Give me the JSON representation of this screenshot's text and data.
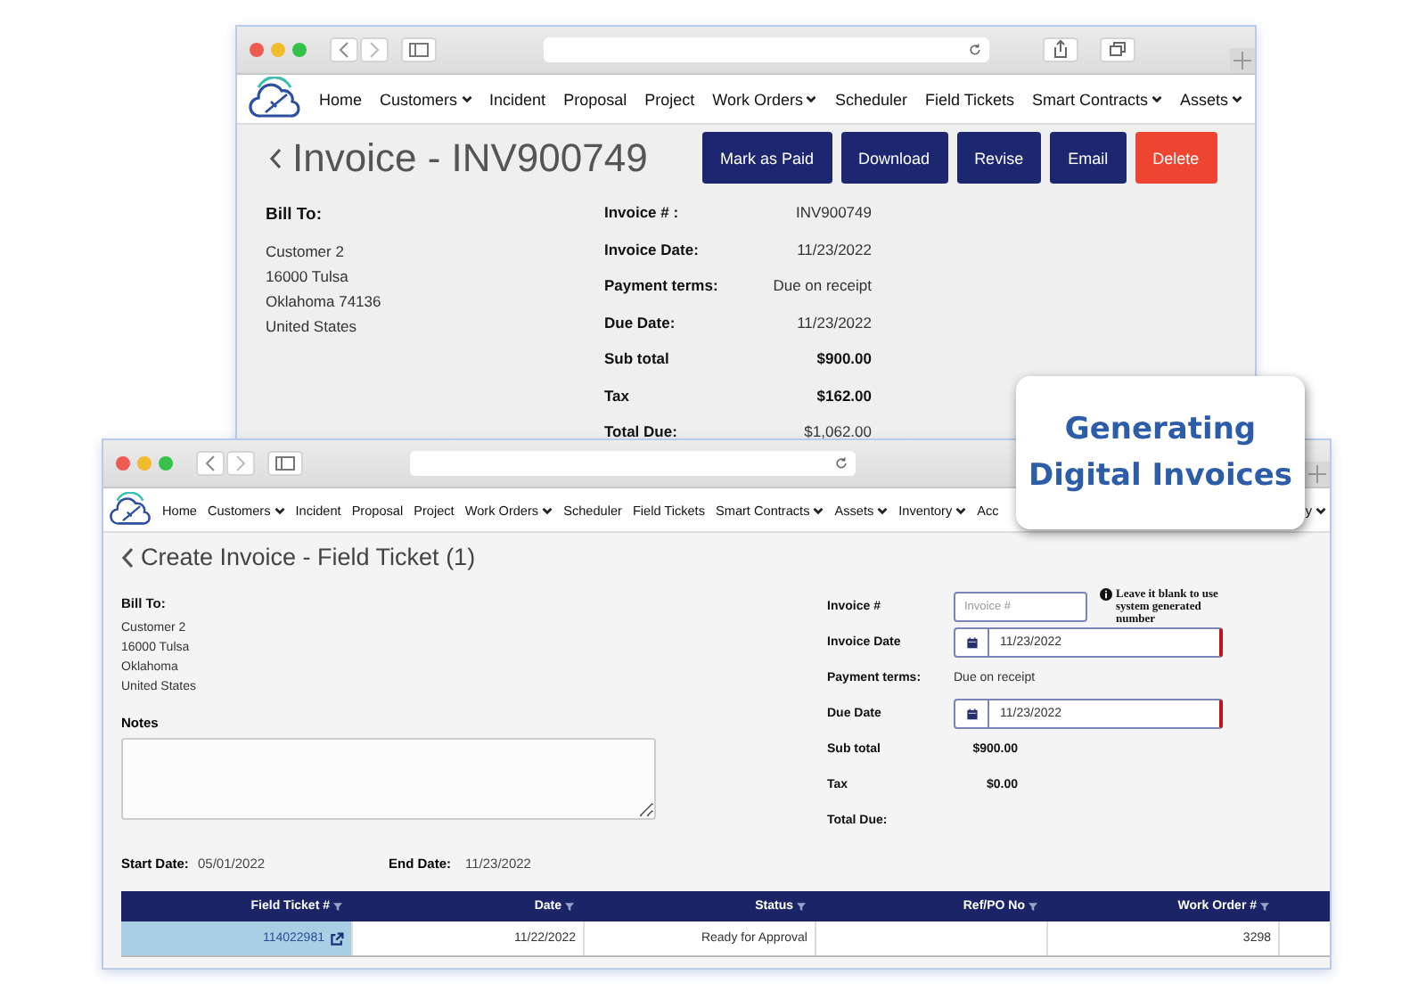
{
  "invoice_window": {
    "nav": [
      {
        "label": "Home",
        "dropdown": false
      },
      {
        "label": "Customers",
        "dropdown": true
      },
      {
        "label": "Incident",
        "dropdown": false
      },
      {
        "label": "Proposal",
        "dropdown": false
      },
      {
        "label": "Project",
        "dropdown": false
      },
      {
        "label": "Work Orders",
        "dropdown": true
      },
      {
        "label": "Scheduler",
        "dropdown": false
      },
      {
        "label": "Field Tickets",
        "dropdown": false
      },
      {
        "label": "Smart Contracts",
        "dropdown": true
      },
      {
        "label": "Assets",
        "dropdown": true
      }
    ],
    "title": "Invoice - INV900749",
    "buttons": [
      {
        "label": "Mark as Paid",
        "kind": "primary"
      },
      {
        "label": "Download",
        "kind": "primary"
      },
      {
        "label": "Revise",
        "kind": "primary"
      },
      {
        "label": "Email",
        "kind": "primary"
      },
      {
        "label": "Delete",
        "kind": "danger"
      }
    ],
    "bill_to": {
      "label": "Bill To:",
      "lines": [
        "Customer 2",
        "16000 Tulsa",
        "Oklahoma 74136",
        "United States"
      ]
    },
    "details": [
      {
        "label": "Invoice # :",
        "value": "INV900749",
        "bold": false
      },
      {
        "label": "Invoice Date:",
        "value": "11/23/2022",
        "bold": false
      },
      {
        "label": "Payment terms:",
        "value": "Due on receipt",
        "bold": false
      },
      {
        "label": "Due Date:",
        "value": "11/23/2022",
        "bold": false
      },
      {
        "label": "Sub total",
        "value": "$900.00",
        "bold": true
      },
      {
        "label": "Tax",
        "value": "$162.00",
        "bold": true
      },
      {
        "label": "Total Due:",
        "value": "$1,062.00",
        "bold": false
      }
    ]
  },
  "create_window": {
    "nav": [
      {
        "label": "Home",
        "dropdown": false
      },
      {
        "label": "Customers",
        "dropdown": true
      },
      {
        "label": "Incident",
        "dropdown": false
      },
      {
        "label": "Proposal",
        "dropdown": false
      },
      {
        "label": "Project",
        "dropdown": false
      },
      {
        "label": "Work Orders",
        "dropdown": true
      },
      {
        "label": "Scheduler",
        "dropdown": false
      },
      {
        "label": "Field Tickets",
        "dropdown": false
      },
      {
        "label": "Smart Contracts",
        "dropdown": true
      },
      {
        "label": "Assets",
        "dropdown": true
      },
      {
        "label": "Inventory",
        "dropdown": true
      },
      {
        "label": "Acc",
        "dropdown": false
      }
    ],
    "nav_end": {
      "label": "y",
      "dropdown": true
    },
    "title": "Create Invoice - Field Ticket (1)",
    "bill_to": {
      "label": "Bill To:",
      "lines": [
        "Customer 2",
        "16000 Tulsa",
        "Oklahoma",
        "United States"
      ]
    },
    "notes": {
      "label": "Notes"
    },
    "fields": [
      {
        "label": "Invoice #",
        "kind": "input",
        "placeholder": "Invoice #",
        "hint": "Leave it blank to use system generated number"
      },
      {
        "label": "Invoice Date",
        "kind": "date",
        "value": "11/23/2022"
      },
      {
        "label": "Payment terms:",
        "kind": "text",
        "value": "Due on receipt"
      },
      {
        "label": "Due Date",
        "kind": "date",
        "value": "11/23/2022"
      },
      {
        "label": "Sub total",
        "kind": "amount",
        "value": "$900.00"
      },
      {
        "label": "Tax",
        "kind": "amount",
        "value": "$0.00"
      },
      {
        "label": "Total Due:",
        "kind": "amount"
      }
    ],
    "dates": [
      {
        "label": "Start Date:",
        "value": "05/01/2022"
      },
      {
        "label": "End Date:",
        "value": "11/23/2022"
      }
    ],
    "table": {
      "columns": [
        "Field Ticket #",
        "Date",
        "Status",
        "Ref/PO No",
        "Work Order #"
      ],
      "rows": [
        {
          "cells": [
            {
              "text": "114022981",
              "kind": "link"
            },
            {
              "text": "11/22/2022",
              "kind": "text"
            },
            {
              "text": "Ready for Approval",
              "kind": "text"
            },
            {
              "text": "",
              "kind": "text"
            },
            {
              "text": "3298",
              "kind": "text"
            }
          ]
        }
      ]
    }
  },
  "callout": {
    "text": "Generating Digital Invoices"
  }
}
